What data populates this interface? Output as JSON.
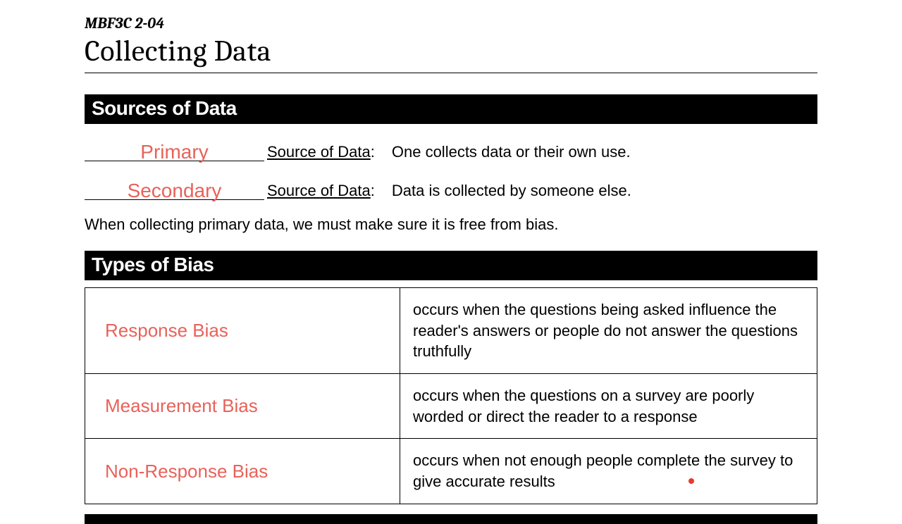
{
  "header": {
    "course_code": "MBF3C 2-04",
    "title": "Collecting Data"
  },
  "sections": {
    "sources": {
      "heading": "Sources of Data",
      "rows": [
        {
          "fill": "Primary",
          "label": "Source of Data",
          "desc": "One collects data or their own use."
        },
        {
          "fill": "Secondary",
          "label": "Source of Data",
          "desc": "Data is collected by someone else."
        }
      ],
      "note": "When collecting primary data, we must make sure it is free from bias."
    },
    "bias": {
      "heading": "Types of Bias",
      "rows": [
        {
          "term": "Response Bias",
          "desc": "occurs when the questions being asked influence the reader's answers or people do not answer the questions truthfully"
        },
        {
          "term": "Measurement Bias",
          "desc": "occurs when the questions on a survey are poorly worded or direct the reader to a response"
        },
        {
          "term": "Non-Response Bias",
          "desc": "occurs when not enough people complete the survey to give accurate results"
        }
      ]
    }
  }
}
